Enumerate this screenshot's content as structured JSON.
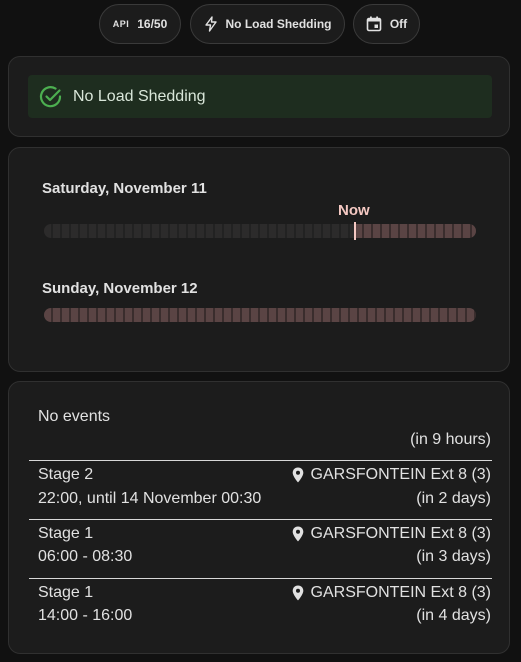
{
  "chips": {
    "api_badge": "API",
    "api_quota": "16/50",
    "status": "No Load Shedding",
    "calendar": "Off"
  },
  "status_alert": "No Load Shedding",
  "timeline": {
    "days": [
      {
        "label": "Saturday, November 11",
        "now_fraction": 0.72
      },
      {
        "label": "Sunday, November 12"
      }
    ],
    "now_label": "Now"
  },
  "events": {
    "header": "No events",
    "header_in": "(in 9 hours)",
    "items": [
      {
        "stage": "Stage 2",
        "time": "22:00, until 14 November 00:30",
        "area": "GARSFONTEIN Ext 8 (3)",
        "in": "(in 2 days)"
      },
      {
        "stage": "Stage 1",
        "time": "06:00 - 08:30",
        "area": "GARSFONTEIN Ext 8 (3)",
        "in": "(in 3 days)"
      },
      {
        "stage": "Stage 1",
        "time": "14:00 - 16:00",
        "area": "GARSFONTEIN Ext 8 (3)",
        "in": "(in 4 days)"
      }
    ]
  },
  "icons": {
    "api": "api-icon",
    "status": "lightning-icon",
    "calendar": "calendar-icon",
    "alert": "check-circle-icon",
    "location": "map-pin-icon"
  },
  "colors": {
    "background": "#111111",
    "card": "#1c1c1c",
    "alert_bg": "#1e2d1f",
    "success": "#4caf50",
    "now": "#f4c8c2",
    "future_bar": "#5a4444",
    "past_bar": "#2c2b2b"
  }
}
